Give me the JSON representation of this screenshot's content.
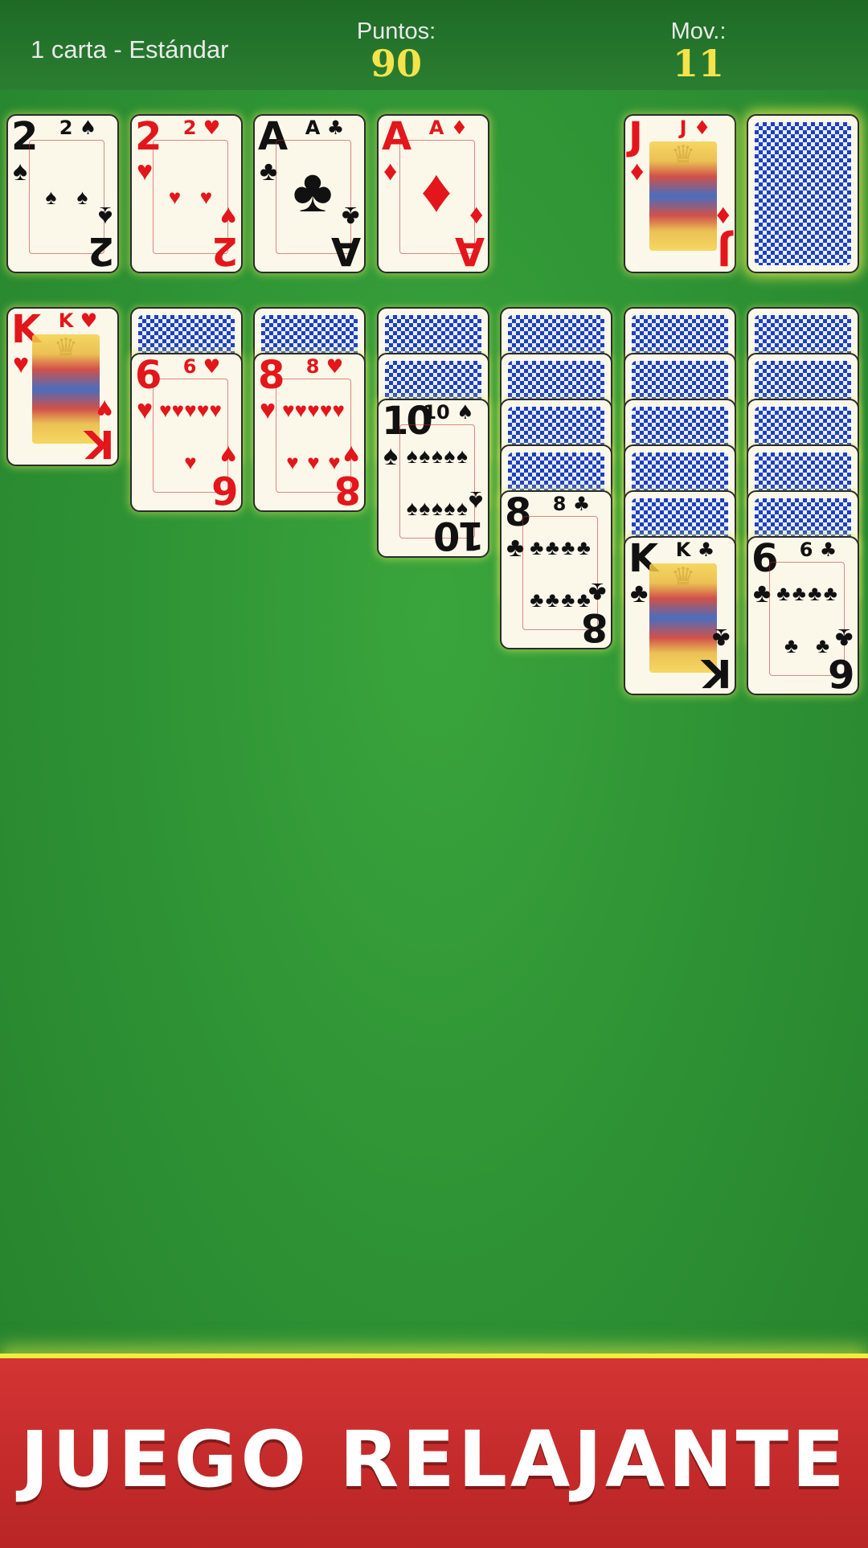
{
  "header": {
    "mode_label": "1 carta - Estándar",
    "score_label": "Puntos:",
    "score_value": "90",
    "moves_label": "Mov.:",
    "moves_value": "11"
  },
  "foundations": [
    {
      "rank": "2",
      "suit": "♠",
      "color": "black"
    },
    {
      "rank": "2",
      "suit": "♥",
      "color": "red"
    },
    {
      "rank": "A",
      "suit": "♣",
      "color": "black"
    },
    {
      "rank": "A",
      "suit": "♦",
      "color": "red"
    }
  ],
  "waste": {
    "rank": "J",
    "suit": "♦",
    "color": "red"
  },
  "stock": {
    "state": "face-down"
  },
  "tableau": [
    {
      "hidden": 0,
      "card": {
        "rank": "K",
        "suit": "♥",
        "color": "red"
      }
    },
    {
      "hidden": 1,
      "card": {
        "rank": "6",
        "suit": "♥",
        "color": "red"
      }
    },
    {
      "hidden": 1,
      "card": {
        "rank": "8",
        "suit": "♥",
        "color": "red"
      }
    },
    {
      "hidden": 2,
      "card": {
        "rank": "10",
        "suit": "♠",
        "color": "black"
      }
    },
    {
      "hidden": 4,
      "card": {
        "rank": "8",
        "suit": "♣",
        "color": "black"
      }
    },
    {
      "hidden": 5,
      "card": {
        "rank": "K",
        "suit": "♣",
        "color": "black"
      }
    },
    {
      "hidden": 5,
      "card": {
        "rank": "6",
        "suit": "♣",
        "color": "black"
      }
    }
  ],
  "banner": {
    "text": "JUEGO RELAJANTE"
  },
  "colors": {
    "felt": "#2f9435",
    "banner": "#c42a2a",
    "score": "#f5e34b"
  }
}
